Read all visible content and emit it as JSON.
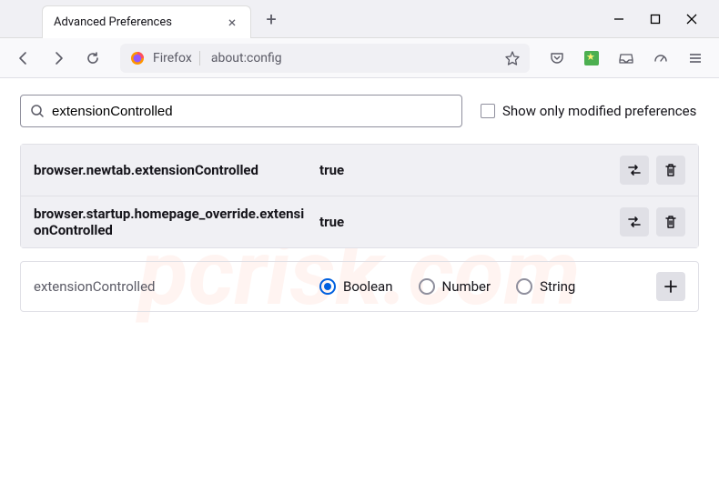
{
  "tab": {
    "title": "Advanced Preferences"
  },
  "urlbar": {
    "identity": "Firefox",
    "url": "about:config"
  },
  "search": {
    "value": "extensionControlled",
    "checkbox_label": "Show only modified preferences"
  },
  "prefs": [
    {
      "name": "browser.newtab.extensionControlled",
      "value": "true"
    },
    {
      "name": "browser.startup.homepage_override.extensionControlled",
      "value": "true"
    }
  ],
  "new_pref": {
    "name": "extensionControlled",
    "types": [
      "Boolean",
      "Number",
      "String"
    ],
    "selected": "Boolean"
  }
}
